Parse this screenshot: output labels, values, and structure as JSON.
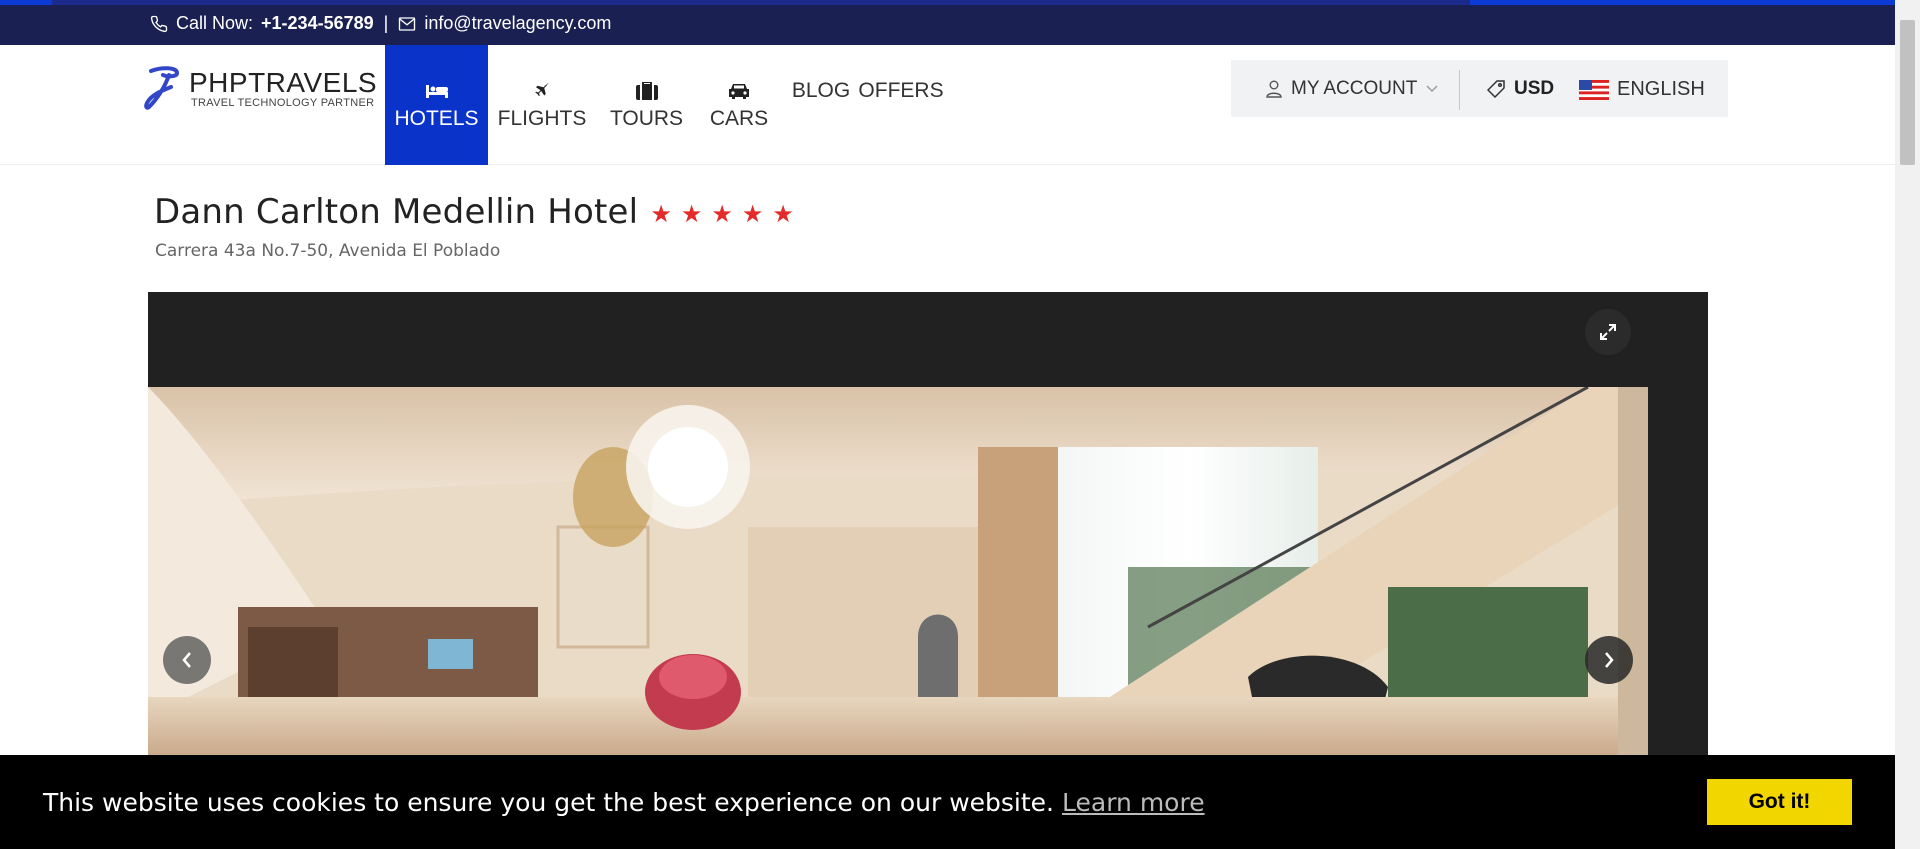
{
  "topbar": {
    "call_label": "Call Now:",
    "phone": "+1-234-56789",
    "separator": "|",
    "email": "info@travelagency.com"
  },
  "brand": {
    "name": "PHPTRAVELS",
    "tagline": "TRAVEL TECHNOLOGY PARTNER"
  },
  "nav": {
    "items": [
      {
        "label": "HOTELS",
        "icon": "bed-icon",
        "active": true
      },
      {
        "label": "FLIGHTS",
        "icon": "plane-icon",
        "active": false
      },
      {
        "label": "TOURS",
        "icon": "suitcase-icon",
        "active": false
      },
      {
        "label": "CARS",
        "icon": "car-icon",
        "active": false
      },
      {
        "label": "BLOG",
        "icon": "",
        "active": false
      },
      {
        "label": "OFFERS",
        "icon": "",
        "active": false
      }
    ]
  },
  "account": {
    "label": "MY ACCOUNT",
    "currency": "USD",
    "language": "ENGLISH"
  },
  "hotel": {
    "name": "Dann Carlton Medellin Hotel",
    "stars": 5,
    "address": "Carrera 43a No.7-50, Avenida El Poblado"
  },
  "cookie": {
    "message": "This website uses cookies to ensure you get the best experience on our website.",
    "link": "Learn more",
    "button": "Got it!"
  },
  "colors": {
    "topbar": "#1a2152",
    "nav_active": "#0a34c9",
    "star": "#e32b2b",
    "cookie_button": "#f1d600"
  }
}
